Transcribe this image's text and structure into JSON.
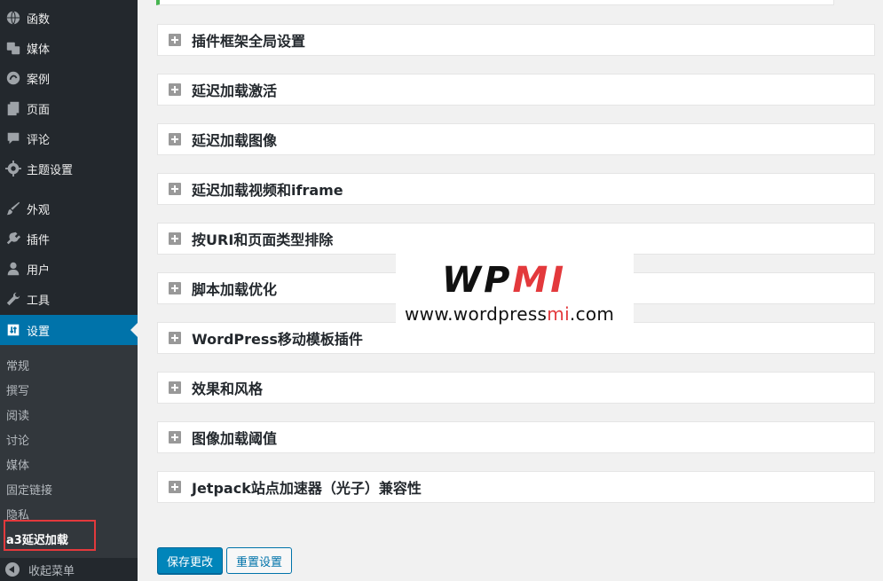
{
  "sidebar": {
    "items": [
      {
        "icon": "globe-icon",
        "label": "函数"
      },
      {
        "icon": "media-icon",
        "label": "媒体"
      },
      {
        "icon": "case-icon",
        "label": "案例"
      },
      {
        "icon": "page-icon",
        "label": "页面"
      },
      {
        "icon": "comment-icon",
        "label": "评论"
      },
      {
        "icon": "gear-icon",
        "label": "主题设置"
      },
      {
        "icon": "brush-icon",
        "label": "外观"
      },
      {
        "icon": "plugin-icon",
        "label": "插件"
      },
      {
        "icon": "user-icon",
        "label": "用户"
      },
      {
        "icon": "wrench-icon",
        "label": "工具"
      },
      {
        "icon": "settings-icon",
        "label": "设置"
      }
    ],
    "submenu": [
      "常规",
      "撰写",
      "阅读",
      "讨论",
      "媒体",
      "固定链接",
      "隐私",
      "a3延迟加载"
    ],
    "collapse_label": "收起菜单"
  },
  "panels": [
    "插件框架全局设置",
    "延迟加载激活",
    "延迟加载图像",
    "延迟加载视频和iframe",
    "按URI和页面类型排除",
    "脚本加载优化",
    "WordPress移动模板插件",
    "效果和风格",
    "图像加载阈值",
    "Jetpack站点加速器（光子）兼容性"
  ],
  "buttons": {
    "save": "保存更改",
    "reset": "重置设置"
  },
  "watermark": {
    "logo_main": "WP",
    "logo_accent": "MI",
    "url_main": "www.wordpress",
    "url_accent": "mi",
    "url_tail": ".com"
  },
  "colors": {
    "sidebar_bg": "#23282d",
    "active_bg": "#0073aa",
    "primary_button": "#0085ba",
    "highlight": "#e3393c",
    "notice_border": "#46b450"
  }
}
